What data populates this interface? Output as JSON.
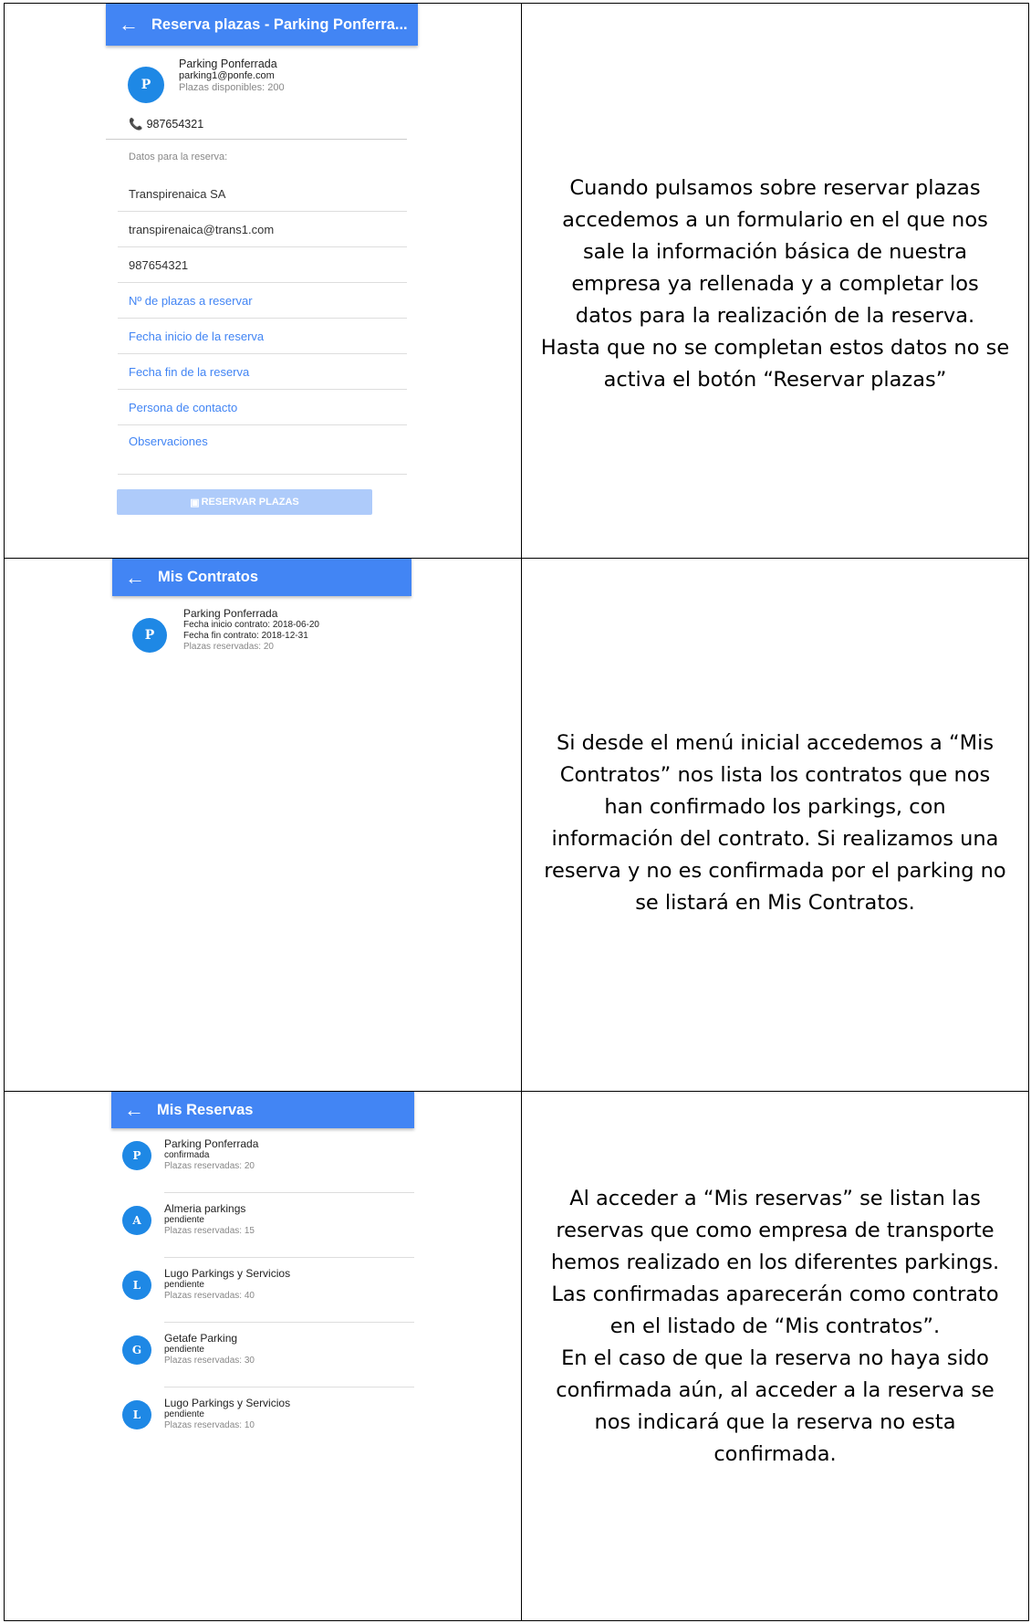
{
  "reserva": {
    "title": "Reserva plazas - Parking Ponferra...",
    "parking_name": "Parking Ponferrada",
    "email": "parking1@ponfe.com",
    "plazas": "Plazas disponibles: 200",
    "avatar": "P",
    "phone": "987654321",
    "section_label": "Datos para la reserva:",
    "company": "Transpirenaica SA",
    "company_email": "transpirenaica@trans1.com",
    "company_phone": "987654321",
    "ph_plazas": "Nº de plazas a reservar",
    "ph_inicio": "Fecha inicio de la reserva",
    "ph_fin": "Fecha fin de la reserva",
    "ph_contacto": "Persona de contacto",
    "ph_obs": "Observaciones",
    "button": "RESERVAR PLAZAS"
  },
  "contratos": {
    "title": "Mis Contratos",
    "avatar": "P",
    "name": "Parking Ponferrada",
    "inicio": "Fecha inicio contrato: 2018-06-20",
    "fin": "Fecha fin contrato: 2018-12-31",
    "plazas": "Plazas reservadas: 20"
  },
  "reservas": {
    "title": "Mis Reservas",
    "items": [
      {
        "avatar": "P",
        "name": "Parking Ponferrada",
        "status": "confirmada",
        "plazas": "Plazas reservadas: 20"
      },
      {
        "avatar": "A",
        "name": "Almeria parkings",
        "status": "pendiente",
        "plazas": "Plazas reservadas: 15"
      },
      {
        "avatar": "L",
        "name": "Lugo Parkings y Servicios",
        "status": "pendiente",
        "plazas": "Plazas reservadas: 40"
      },
      {
        "avatar": "G",
        "name": "Getafe Parking",
        "status": "pendiente",
        "plazas": "Plazas reservadas: 30"
      },
      {
        "avatar": "L",
        "name": "Lugo Parkings y Servicios",
        "status": "pendiente",
        "plazas": "Plazas reservadas: 10"
      }
    ]
  },
  "descriptions": {
    "d1": [
      "Cuando pulsamos sobre reservar plazas",
      "accedemos a un formulario en el que nos",
      "sale la información básica de nuestra",
      "empresa ya rellenada y a completar los",
      "datos para la realización de la reserva.",
      "Hasta que no se completan estos datos no se",
      "activa el botón “Reservar plazas”"
    ],
    "d2": [
      "Si desde el menú inicial accedemos a “Mis",
      "Contratos” nos lista los contratos que nos",
      "han confirmado los parkings, con",
      "información del contrato. Si realizamos una",
      "reserva y no es confirmada por el parking no",
      "se listará en Mis Contratos."
    ],
    "d3": [
      "Al acceder a “Mis reservas” se listan las",
      "reservas que como empresa de transporte",
      "hemos realizado en los diferentes parkings.",
      "Las confirmadas aparecerán como contrato",
      "en el listado de “Mis contratos”.",
      "En el caso de que la reserva no haya sido",
      "confirmada aún, al acceder a la reserva se",
      "nos indicará que la reserva no esta",
      "confirmada."
    ]
  }
}
